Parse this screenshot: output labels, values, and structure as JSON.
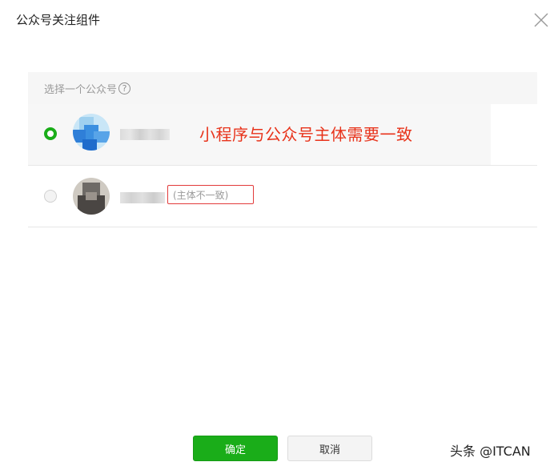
{
  "dialog": {
    "title": "公众号关注组件",
    "close_icon": "close-icon"
  },
  "panel": {
    "header_label": "选择一个公众号",
    "help_icon": "?"
  },
  "accounts": [
    {
      "selected": true,
      "annotation": "小程序与公众号主体需要一致"
    },
    {
      "selected": false,
      "status_badge": "(主体不一致)"
    }
  ],
  "footer": {
    "confirm_label": "确定",
    "cancel_label": "取消"
  },
  "watermark": "头条 @ITCAN",
  "colors": {
    "accent_green": "#1aad19",
    "annotation_red": "#e8331b"
  }
}
